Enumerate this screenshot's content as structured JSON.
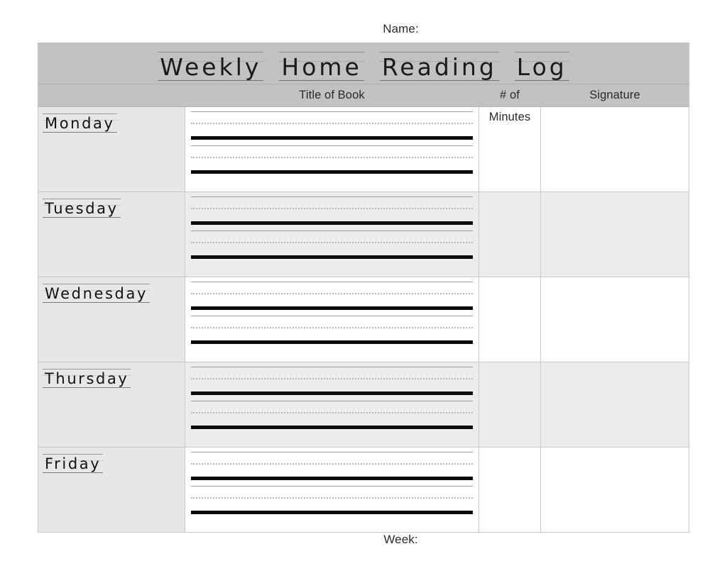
{
  "document": {
    "title_words": [
      "Weekly",
      "Home",
      "Reading",
      "Log"
    ],
    "name_label": "Name:",
    "week_label": "Week:"
  },
  "table": {
    "columns": [
      {
        "key": "day",
        "label": ""
      },
      {
        "key": "title",
        "label": "Title of Book"
      },
      {
        "key": "minutes",
        "label": "# of Minutes"
      },
      {
        "key": "signature",
        "label": "Signature"
      }
    ],
    "rows": [
      {
        "day": "Monday",
        "title": "",
        "minutes": "",
        "signature": "",
        "shaded": false
      },
      {
        "day": "Tuesday",
        "title": "",
        "minutes": "",
        "signature": "",
        "shaded": true
      },
      {
        "day": "Wednesday",
        "title": "",
        "minutes": "",
        "signature": "",
        "shaded": false
      },
      {
        "day": "Thursday",
        "title": "",
        "minutes": "",
        "signature": "",
        "shaded": true
      },
      {
        "day": "Friday",
        "title": "",
        "minutes": "",
        "signature": "",
        "shaded": false
      }
    ],
    "writing_lines_per_row": 2
  },
  "colors": {
    "page_background": "#ffffff",
    "header_band": "#c2c2c2",
    "day_column": "#e7e7e7",
    "shaded_row": "#ececec",
    "grid_line": "#c9c9c9",
    "baseline": "#0b0b0b",
    "guide_line": "#9e9e9e",
    "dotted_midline": "#b9b9b9",
    "text": "#1a1a1a"
  }
}
